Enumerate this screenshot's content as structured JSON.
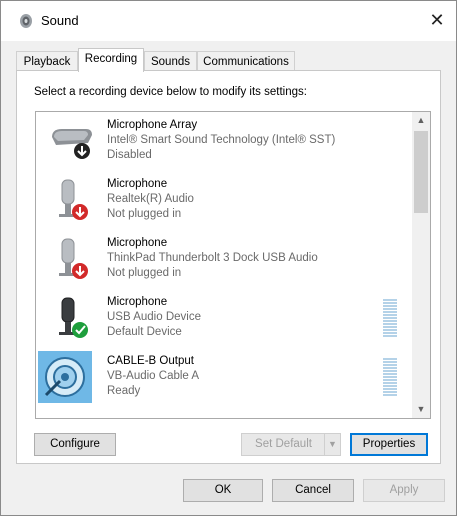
{
  "window": {
    "title": "Sound",
    "close_glyph": "✕"
  },
  "tabs": [
    {
      "label": "Playback",
      "active": false
    },
    {
      "label": "Recording",
      "active": true
    },
    {
      "label": "Sounds",
      "active": false
    },
    {
      "label": "Communications",
      "active": false
    }
  ],
  "instruction": "Select a recording device below to modify its settings:",
  "devices": [
    {
      "name": "Microphone Array",
      "description": "Intel® Smart Sound Technology (Intel® SST)",
      "status": "Disabled",
      "icon": "microphone-array-icon",
      "badge": "disabled-arrow-badge"
    },
    {
      "name": "Microphone",
      "description": "Realtek(R) Audio",
      "status": "Not plugged in",
      "icon": "microphone-icon",
      "badge": "unplugged-badge"
    },
    {
      "name": "Microphone",
      "description": "ThinkPad Thunderbolt 3 Dock USB Audio",
      "status": "Not plugged in",
      "icon": "microphone-icon",
      "badge": "unplugged-badge"
    },
    {
      "name": "Microphone",
      "description": "USB Audio Device",
      "status": "Default Device",
      "icon": "microphone-icon",
      "badge": "default-check-badge"
    },
    {
      "name": "CABLE-B Output",
      "description": "VB-Audio Cable A",
      "status": "Ready",
      "icon": "virtual-cable-icon",
      "badge": ""
    }
  ],
  "panel_buttons": {
    "configure": "Configure",
    "set_default": "Set Default",
    "properties": "Properties"
  },
  "dialog_buttons": {
    "ok": "OK",
    "cancel": "Cancel",
    "apply": "Apply"
  },
  "colors": {
    "accent": "#0078d7",
    "default_check": "#1e9e3c",
    "unplugged_red": "#d22a2a",
    "level_meter": "#b4d2e8"
  }
}
